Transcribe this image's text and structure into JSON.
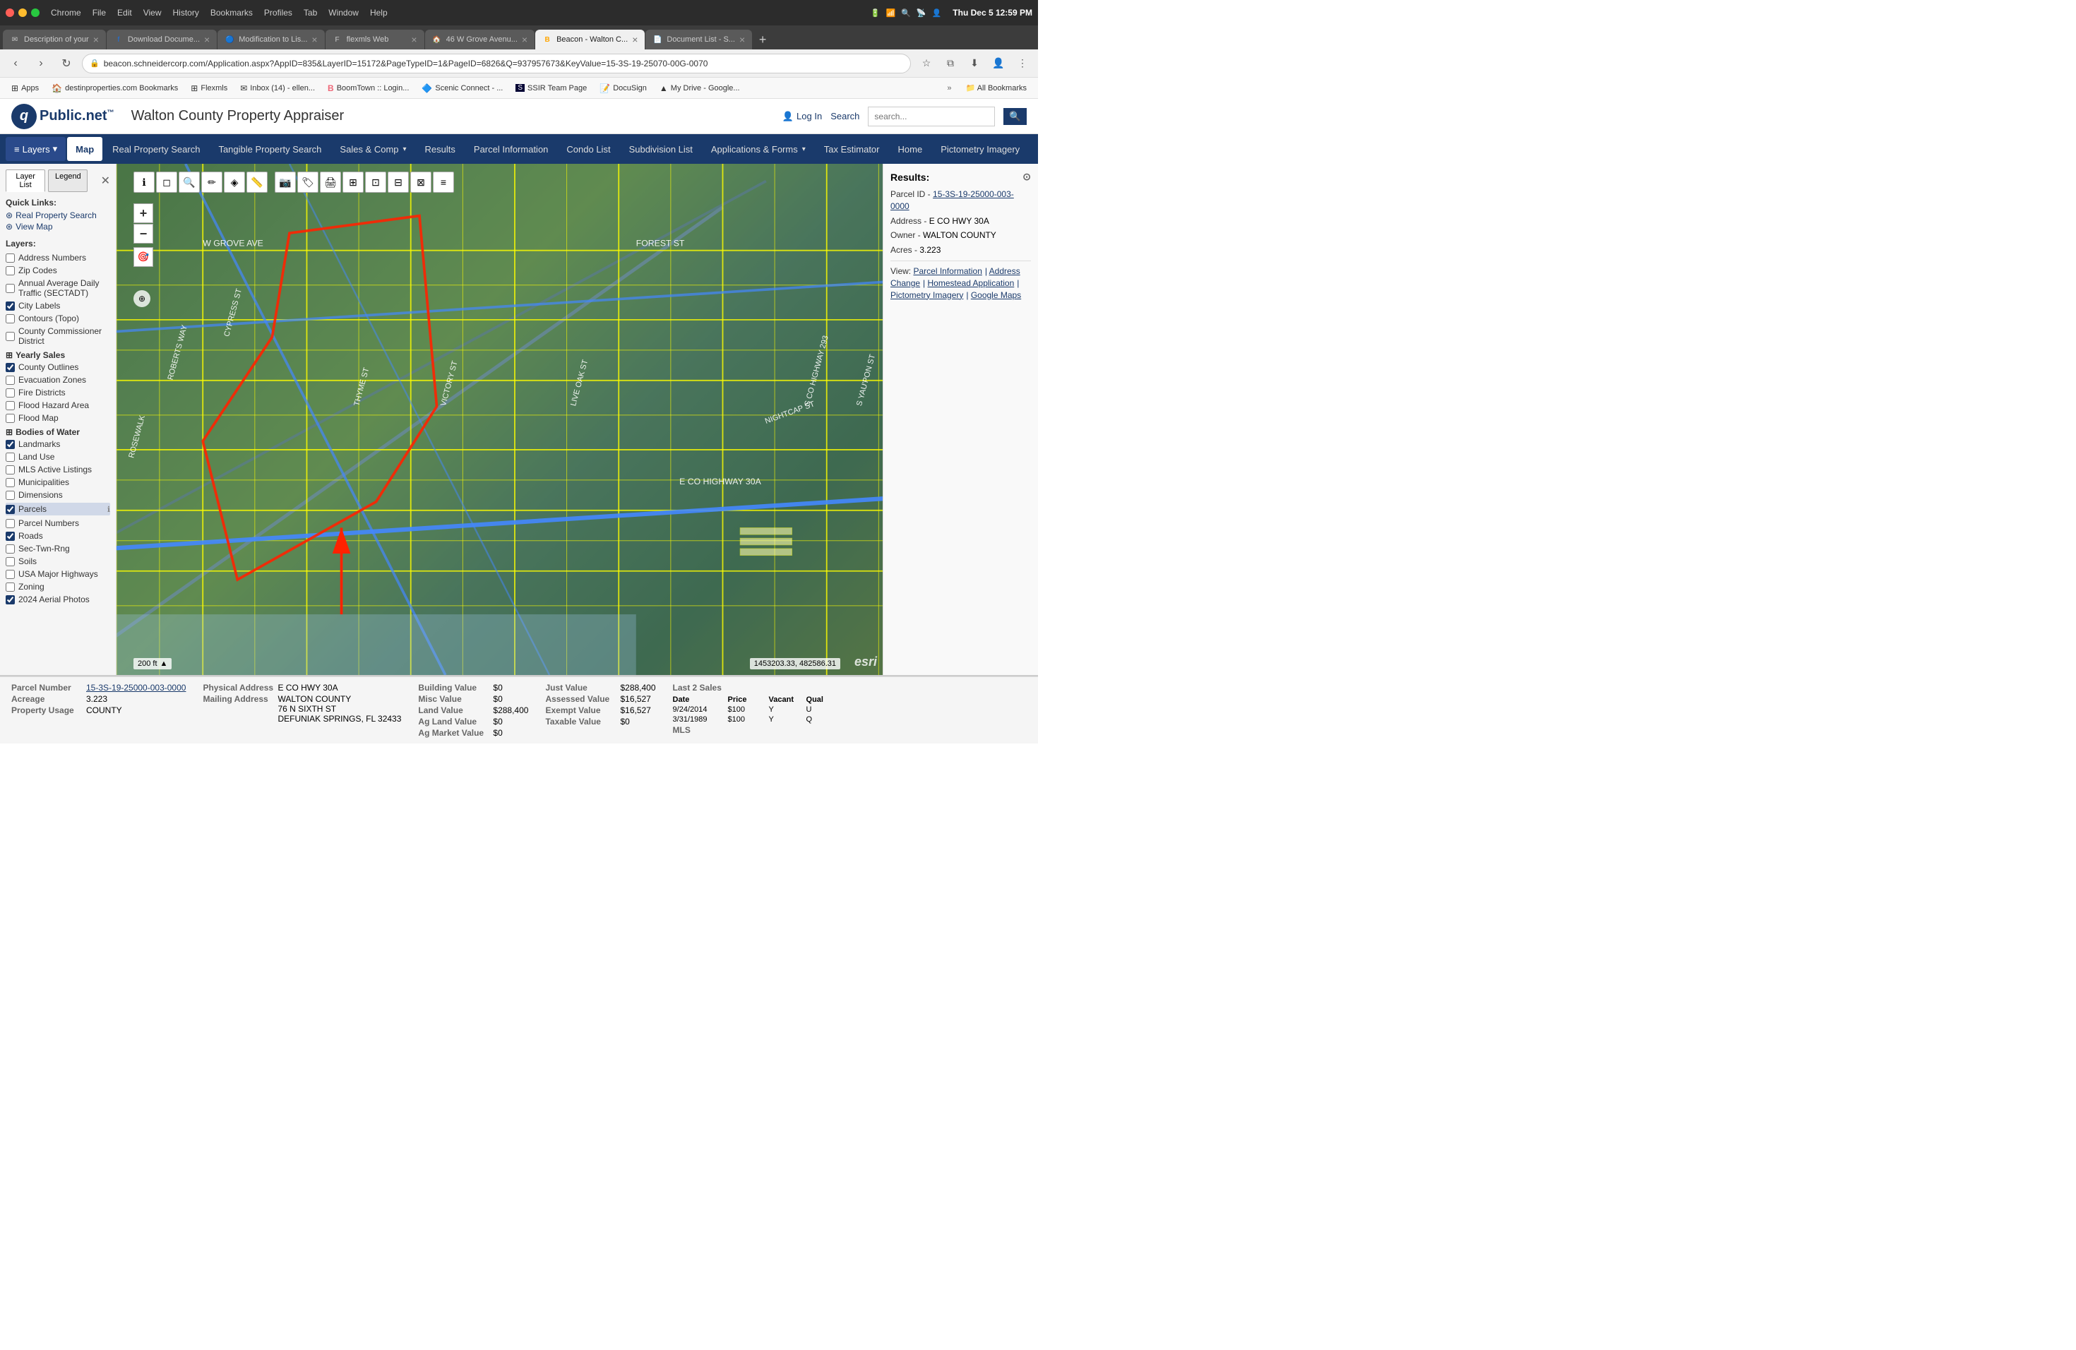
{
  "browser": {
    "menu_items": [
      "Chrome",
      "File",
      "Edit",
      "View",
      "History",
      "Bookmarks",
      "Profiles",
      "Tab",
      "Window",
      "Help"
    ],
    "tabs": [
      {
        "id": "tab1",
        "favicon": "✉",
        "title": "Description of your",
        "active": false
      },
      {
        "id": "tab2",
        "favicon": "f",
        "title": "Download Docume...",
        "active": false
      },
      {
        "id": "tab3",
        "favicon": "🔵",
        "title": "Modification to Lis...",
        "active": false
      },
      {
        "id": "tab4",
        "favicon": "F",
        "title": "flexmls Web",
        "active": false
      },
      {
        "id": "tab5",
        "favicon": "🏠",
        "title": "46 W Grove Avenu...",
        "active": false
      },
      {
        "id": "tab6",
        "favicon": "B",
        "title": "Beacon - Walton C...",
        "active": true
      },
      {
        "id": "tab7",
        "favicon": "📄",
        "title": "Document List - S...",
        "active": false
      }
    ],
    "url": "beacon.schneidercorp.com/Application.aspx?AppID=835&LayerID=15172&PageTypeID=1&PageID=6826&Q=937957673&KeyValue=15-3S-19-25070-00G-0070",
    "time": "Thu Dec 5   12:59 PM"
  },
  "bookmarks": [
    {
      "icon": "⊞",
      "label": "Apps"
    },
    {
      "icon": "🏠",
      "label": "destinproperties.com Bookmarks"
    },
    {
      "icon": "⊞",
      "label": "Flexmls"
    },
    {
      "icon": "✉",
      "label": "Inbox (14) - ellen..."
    },
    {
      "icon": "B",
      "label": "BoomTown :: Login..."
    },
    {
      "icon": "🔷",
      "label": "Scenic Connect - ..."
    },
    {
      "icon": "S",
      "label": "SSIR Team Page"
    },
    {
      "icon": "📝",
      "label": "DocuSign"
    },
    {
      "icon": "▲",
      "label": "My Drive - Google..."
    }
  ],
  "app": {
    "logo_text": "qPublic.net",
    "tm": "™",
    "county_name": "Walton County Property Appraiser",
    "login_label": "Log In",
    "search_label": "Search",
    "search_placeholder": "search..."
  },
  "nav": {
    "layers_btn": "≡ Layers",
    "items": [
      "Map",
      "Real Property Search",
      "Tangible Property Search",
      "Sales & Comp",
      "Results",
      "Parcel Information",
      "Condo List",
      "Subdivision List",
      "Applications & Forms",
      "Tax Estimator",
      "Home",
      "Pictometry Imagery"
    ]
  },
  "sidebar": {
    "tab_layer_list": "Layer List",
    "tab_legend": "Legend",
    "quick_links_title": "Quick Links:",
    "quick_links": [
      {
        "label": "Real Property Search"
      },
      {
        "label": "View Map"
      }
    ],
    "layers_title": "Layers:",
    "layers": [
      {
        "label": "Address Numbers",
        "checked": false
      },
      {
        "label": "Zip Codes",
        "checked": false
      },
      {
        "label": "Annual Average Daily Traffic (SECTADT)",
        "checked": false
      },
      {
        "label": "City Labels",
        "checked": true
      },
      {
        "label": "Contours (Topo)",
        "checked": false
      },
      {
        "label": "County Commissioner District",
        "checked": false
      },
      {
        "label": "Yearly Sales",
        "checked": false,
        "section": true
      },
      {
        "label": "County Outlines",
        "checked": true
      },
      {
        "label": "Evacuation Zones",
        "checked": false
      },
      {
        "label": "Fire Districts",
        "checked": false
      },
      {
        "label": "Flood Hazard Area",
        "checked": false
      },
      {
        "label": "Flood Map",
        "checked": false
      },
      {
        "label": "Bodies of Water",
        "checked": false,
        "section": true
      },
      {
        "label": "Landmarks",
        "checked": true
      },
      {
        "label": "Land Use",
        "checked": false
      },
      {
        "label": "MLS Active Listings",
        "checked": false
      },
      {
        "label": "Municipalities",
        "checked": false
      },
      {
        "label": "Dimensions",
        "checked": false
      },
      {
        "label": "Parcels",
        "checked": true,
        "info": true
      },
      {
        "label": "Parcel Numbers",
        "checked": false
      },
      {
        "label": "Roads",
        "checked": true
      },
      {
        "label": "Sec-Twn-Rng",
        "checked": false
      },
      {
        "label": "Soils",
        "checked": false
      },
      {
        "label": "USA Major Highways",
        "checked": false
      },
      {
        "label": "Zoning",
        "checked": false
      },
      {
        "label": "2024 Aerial Photos",
        "checked": true
      }
    ]
  },
  "results": {
    "title": "Results:",
    "parcel_id_label": "Parcel ID -",
    "parcel_id_value": "15-3S-19-25000-003-0000",
    "address_label": "Address -",
    "address_value": "E CO HWY 30A",
    "owner_label": "Owner -",
    "owner_value": "WALTON COUNTY",
    "acres_label": "Acres -",
    "acres_value": "3.223",
    "view_label": "View:",
    "view_links": [
      "Parcel Information",
      "Address Change",
      "Homestead Application",
      "Pictometry Imagery",
      "Google Maps"
    ]
  },
  "bottom_bar": {
    "parcel_number_label": "Parcel Number",
    "parcel_number_value": "15-3S-19-25000-003-0000",
    "acreage_label": "Acreage",
    "acreage_value": "3.223",
    "property_usage_label": "Property Usage",
    "property_usage_value": "COUNTY",
    "physical_address_label": "Physical Address",
    "physical_address_value": "E CO HWY 30A",
    "mailing_address_label": "Mailing Address",
    "mailing_address_line1": "WALTON COUNTY",
    "mailing_address_line2": "76 N SIXTH ST",
    "mailing_address_line3": "DEFUNIAK SPRINGS, FL 32433",
    "building_value_label": "Building Value",
    "building_value": "$0",
    "misc_value_label": "Misc Value",
    "misc_value": "$0",
    "land_value_label": "Land Value",
    "land_value": "$288,400",
    "ag_land_value_label": "Ag Land Value",
    "ag_land_value": "$0",
    "ag_market_value_label": "Ag Market Value",
    "ag_market_value": "$0",
    "just_value_label": "Just Value",
    "just_value": "$288,400",
    "assessed_value_label": "Assessed Value",
    "assessed_value": "$16,527",
    "exempt_value_label": "Exempt Value",
    "exempt_value": "$16,527",
    "taxable_value_label": "Taxable Value",
    "taxable_value": "$0",
    "last2sales_label": "Last 2 Sales",
    "sales_date_label": "Date",
    "sales_price_label": "Price",
    "sales_vacant_label": "Vacant",
    "sales_qual_label": "Qual",
    "sale1_date": "9/24/2014",
    "sale1_price": "$100",
    "sale1_vacant": "Y",
    "sale1_qual": "U",
    "sale2_date": "3/31/1989",
    "sale2_price": "$100",
    "sale2_vacant": "Y",
    "sale2_qual": "Q",
    "mls_label": "MLS"
  },
  "map": {
    "scale_label": "200 ft",
    "coords": "1453203.33, 482586.31",
    "esri_label": "esri"
  },
  "colors": {
    "nav_bg": "#1a3a6b",
    "accent": "#1a3a6b",
    "parcel_outline": "#ffff00",
    "selected_parcel": "#ff2200"
  }
}
